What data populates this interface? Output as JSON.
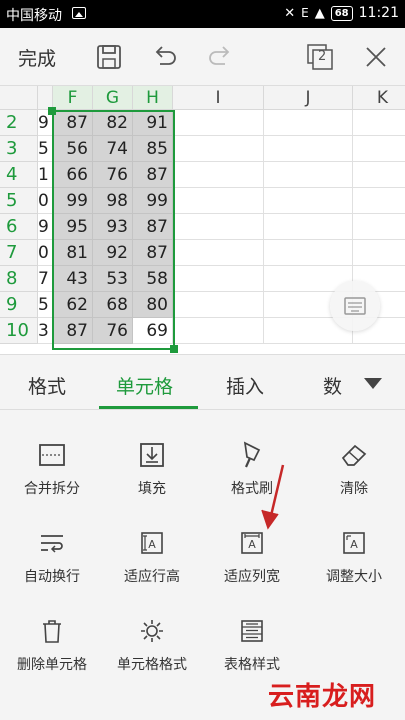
{
  "status": {
    "carrier": "中国移动",
    "net": "E",
    "battery": "68",
    "time": "11:21"
  },
  "toolbar": {
    "done_label": "完成",
    "sheet_count": "2"
  },
  "sheet": {
    "columns": [
      "F",
      "G",
      "H",
      "I",
      "J",
      "K"
    ],
    "rows": [
      {
        "num": "2",
        "e": "9",
        "f": "87",
        "g": "82",
        "h": "91"
      },
      {
        "num": "3",
        "e": "5",
        "f": "56",
        "g": "74",
        "h": "85"
      },
      {
        "num": "4",
        "e": "1",
        "f": "66",
        "g": "76",
        "h": "87"
      },
      {
        "num": "5",
        "e": "0",
        "f": "99",
        "g": "98",
        "h": "99"
      },
      {
        "num": "6",
        "e": "9",
        "f": "95",
        "g": "93",
        "h": "87"
      },
      {
        "num": "7",
        "e": "0",
        "f": "81",
        "g": "92",
        "h": "87"
      },
      {
        "num": "8",
        "e": "7",
        "f": "43",
        "g": "53",
        "h": "58"
      },
      {
        "num": "9",
        "e": "5",
        "f": "62",
        "g": "68",
        "h": "80"
      },
      {
        "num": "10",
        "e": "3",
        "f": "87",
        "g": "76",
        "h": "69"
      }
    ]
  },
  "tabs": [
    {
      "label": "格式"
    },
    {
      "label": "单元格"
    },
    {
      "label": "插入"
    },
    {
      "label": "数"
    }
  ],
  "tools": [
    {
      "label": "合并拆分",
      "icon": "merge-split-icon"
    },
    {
      "label": "填充",
      "icon": "fill-icon"
    },
    {
      "label": "格式刷",
      "icon": "format-brush-icon"
    },
    {
      "label": "清除",
      "icon": "eraser-icon"
    },
    {
      "label": "自动换行",
      "icon": "wrap-text-icon"
    },
    {
      "label": "适应行高",
      "icon": "fit-row-height-icon"
    },
    {
      "label": "适应列宽",
      "icon": "fit-column-width-icon"
    },
    {
      "label": "调整大小",
      "icon": "resize-icon"
    },
    {
      "label": "删除单元格",
      "icon": "delete-cell-icon"
    },
    {
      "label": "单元格格式",
      "icon": "cell-format-icon"
    },
    {
      "label": "表格样式",
      "icon": "table-style-icon"
    }
  ],
  "watermark": "云南龙网",
  "colors": {
    "accent": "#1e9a3c",
    "annotation": "#c62828",
    "watermark": "#d81e1e"
  }
}
